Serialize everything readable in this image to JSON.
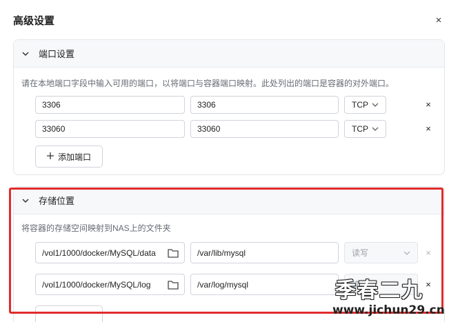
{
  "dialog": {
    "title": "高级设置",
    "close_glyph": "×"
  },
  "ports": {
    "title": "端口设置",
    "hint": "请在本地端口字段中输入可用的端口，以将端口与容器端口映射。此处列出的端口是容器的对外端口。",
    "rows": [
      {
        "local": "3306",
        "container": "3306",
        "protocol": "TCP"
      },
      {
        "local": "33060",
        "container": "33060",
        "protocol": "TCP"
      }
    ],
    "add_label": "添加端口"
  },
  "storage": {
    "title": "存储位置",
    "hint": "将容器的存储空间映射到NAS上的文件夹",
    "rows": [
      {
        "host": "/vol1/1000/docker/MySQL/data",
        "container": "/var/lib/mysql",
        "mode": "读写"
      },
      {
        "host": "/vol1/1000/docker/MySQL/log",
        "container": "/var/log/mysql",
        "mode": "读写"
      }
    ]
  },
  "watermark": {
    "text": "季春二九",
    "url": "www.jichun29.cn"
  },
  "colors": {
    "highlight": "#e02b2b",
    "border": "#cfd3da"
  }
}
